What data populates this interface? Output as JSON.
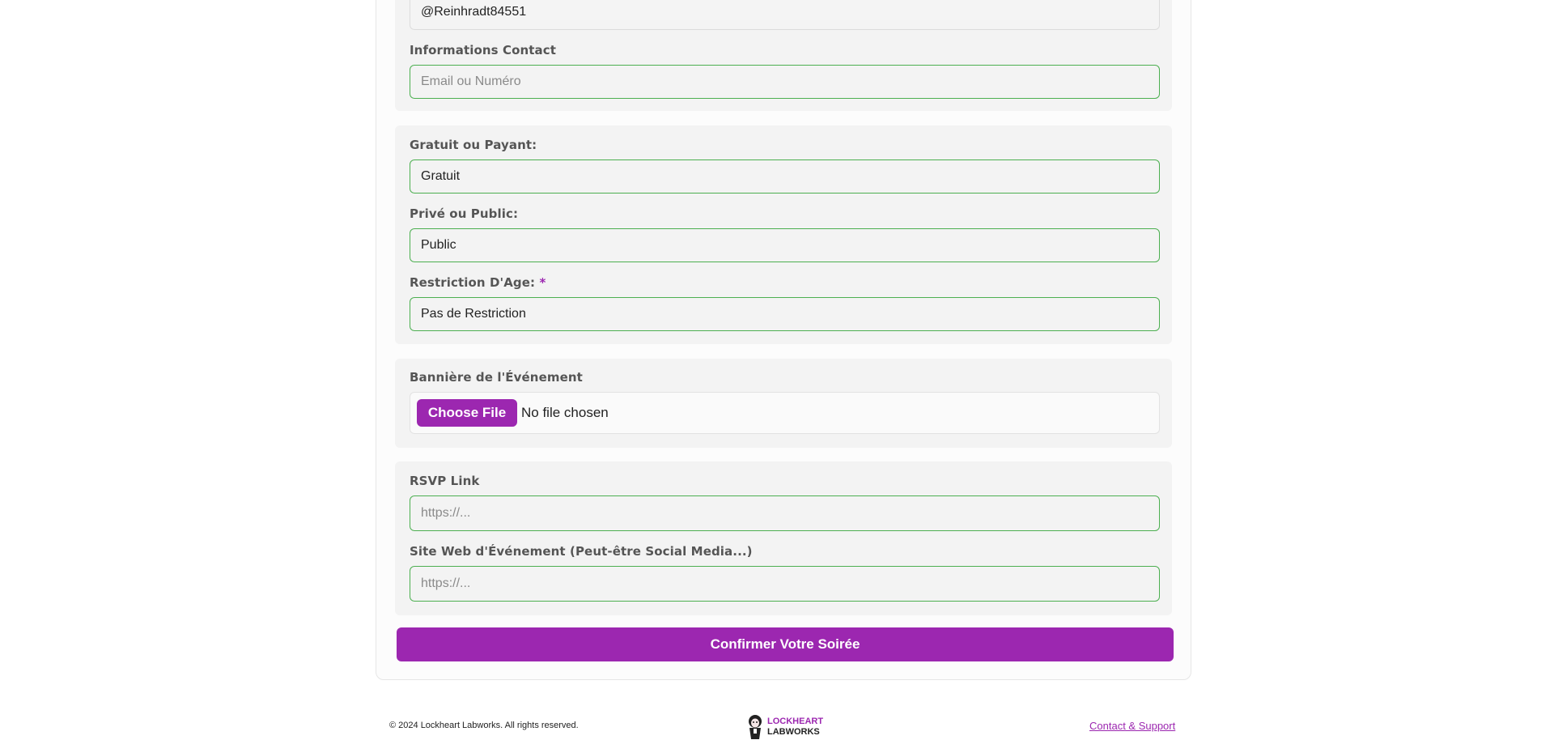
{
  "form": {
    "username_value": "@Reinhradt84551",
    "contact_label": "Informations Contact",
    "contact_placeholder": "Email ou Numéro",
    "price_label": "Gratuit ou Payant:",
    "price_value": "Gratuit",
    "privacy_label": "Privé ou Public:",
    "privacy_value": "Public",
    "age_label": "Restriction D'Age:",
    "age_required_mark": "*",
    "age_value": "Pas de Restriction",
    "banner_label": "Bannière de l'Événement",
    "file_button_label": "Choose File",
    "file_status": "No file chosen",
    "rsvp_label": "RSVP Link",
    "rsvp_placeholder": "https://...",
    "website_label": "Site Web d'Événement (Peut-être Social Media...)",
    "website_placeholder": "https://...",
    "submit_label": "Confirmer Votre Soirée"
  },
  "footer": {
    "copyright": "© 2024 Lockheart Labworks. All rights reserved.",
    "logo_line1": "LOCKHEART",
    "logo_line2": "LABWORKS",
    "contact_link": "Contact & Support"
  },
  "colors": {
    "accent": "#9c27b0",
    "field_border": "#4caf50"
  }
}
